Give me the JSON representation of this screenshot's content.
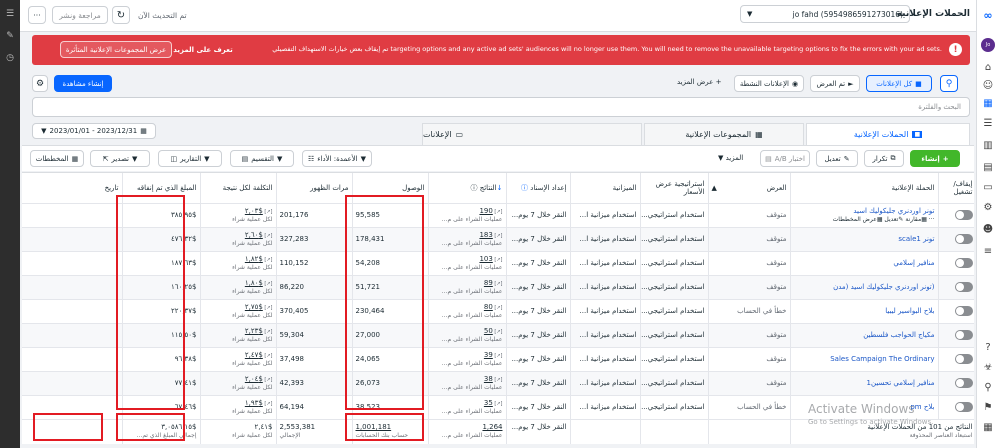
{
  "header": {
    "title": "الحملات الإعلانية",
    "account": "jo fahd (5954986591273016)",
    "updated": "تم التحديث الآن",
    "review_publish": "مراجعة ونشر",
    "more": "···"
  },
  "banner": {
    "text": "تم إيقاف بعض خيارات الاستهداف التفصيلي targeting options and any active ad sets' audiences will no longer use them. You will need to remove the unavailable targeting options to fix the errors with your ad sets.",
    "learn_more": "تعرف على المزيد",
    "view_affected": "عرض المجموعات الإعلانية المتأثرة"
  },
  "filters": {
    "all_ads": "كل الإعلانات",
    "shown": "تم العرض",
    "active_ads": "الإعلانات النشطة",
    "show_more": "عرض المزيد",
    "create_view": "إنشاء مشاهدة"
  },
  "search": {
    "placeholder": "البحث والفلترة"
  },
  "tabs": {
    "campaigns": "الحملات الإعلانية",
    "adsets": "المجموعات الإعلانية",
    "ads": "الإعلانات"
  },
  "date_range": "2023/01/01 - 2023/12/31",
  "toolbar": {
    "create": "إنشاء",
    "duplicate": "تكرار",
    "edit": "تعديل",
    "ab_test": "اختبار A/B",
    "more": "المزيد",
    "columns": "الأعمدة: الأداء",
    "breakdown": "التقسيم",
    "reports": "التقارير",
    "export": "تصدير",
    "charts": "المخططات"
  },
  "columns": {
    "toggle": "إيقاف/تشغيل",
    "campaign": "الحملة الإعلانية",
    "delivery": "العرض",
    "bid_strategy": "استراتيجية عرض الأسعار",
    "budget": "الميزانية",
    "attribution": "إعداد الإسناد",
    "results": "النتائج",
    "reach": "الوصول",
    "impressions": "مرات الظهور",
    "cost_per_result": "التكلفة لكل نتيجة",
    "amount_spent": "المبلغ الذي تم إنفاقه",
    "ends": "تاريخ"
  },
  "row_hover": {
    "charts": "عرض المخططات",
    "edit": "تعديل",
    "compare": "مقارنة"
  },
  "rows": [
    {
      "name": "تونر اوردنري جليكوليك اسيد",
      "delivery": "متوقف",
      "bid": "استخدام استراتيجي...",
      "budget": "استخدام ميزانية ا...",
      "attribution": "النقر خلال 7 يوم...",
      "results": "190",
      "results_sub": "عمليات الشراء على م...",
      "reach": "95,585",
      "impressions": "201,176",
      "cpr": "$٢,٠٣",
      "cpr_sub": "لكل عملية شراء",
      "spent": "$٣٨٥,٩٥"
    },
    {
      "name": "تونر scale1",
      "delivery": "متوقف",
      "bid": "استخدام استراتيجي...",
      "budget": "استخدام ميزانية ا...",
      "attribution": "النقر خلال 7 يوم...",
      "results": "183",
      "results_sub": "عمليات الشراء على م...",
      "reach": "178,431",
      "impressions": "327,283",
      "cpr": "$٢,٦٠",
      "cpr_sub": "لكل عملية شراء",
      "spent": "$٤٧٦,٣٢"
    },
    {
      "name": "منافير إسلامي",
      "delivery": "متوقف",
      "bid": "استخدام استراتيجي...",
      "budget": "استخدام ميزانية ا...",
      "attribution": "النقر خلال 7 يوم...",
      "results": "103",
      "results_sub": "عمليات الشراء على م...",
      "reach": "54,208",
      "impressions": "110,152",
      "cpr": "$١,٨٢",
      "cpr_sub": "لكل عملية شراء",
      "spent": "$١٨٧,٦٣"
    },
    {
      "name": "(تونر اوردنري جليكوليك اسيد (مدن",
      "delivery": "متوقف",
      "bid": "استخدام استراتيجي...",
      "budget": "استخدام ميزانية ا...",
      "attribution": "النقر خلال 7 يوم...",
      "results": "89",
      "results_sub": "عمليات الشراء على م...",
      "reach": "51,721",
      "impressions": "86,220",
      "cpr": "$١,٨٠",
      "cpr_sub": "لكل عملية شراء",
      "spent": "$١٦٠,٢٥"
    },
    {
      "name": "بلاح البواسير ليبيا",
      "delivery": "خطأ في الحساب",
      "bid": "استخدام استراتيجي...",
      "budget": "استخدام ميزانية ا...",
      "attribution": "النقر خلال 7 يوم...",
      "results": "80",
      "results_sub": "عمليات الشراء على م...",
      "reach": "230,464",
      "impressions": "370,405",
      "cpr": "$٢,٧٥",
      "cpr_sub": "لكل عملية شراء",
      "spent": "$٢٢٠,٣٧"
    },
    {
      "name": "مكياج الحواجب فلسطين",
      "delivery": "متوقف",
      "bid": "استخدام استراتيجي...",
      "budget": "استخدام ميزانية ا...",
      "attribution": "النقر خلال 7 يوم...",
      "results": "50",
      "results_sub": "عمليات الشراء على م...",
      "reach": "27,000",
      "impressions": "59,304",
      "cpr": "$٢,٢٣",
      "cpr_sub": "لكل عملية شراء",
      "spent": "$١١٥,٥٠"
    },
    {
      "name": "Sales Campaign The Ordinary",
      "delivery": "متوقف",
      "bid": "استخدام استراتيجي...",
      "budget": "استخدام ميزانية ا...",
      "attribution": "النقر خلال 7 يوم...",
      "results": "39",
      "results_sub": "عمليات الشراء على م...",
      "reach": "24,065",
      "impressions": "37,498",
      "cpr": "$٢,٤٧",
      "cpr_sub": "لكل عملية شراء",
      "spent": "$٩٦,٣٨"
    },
    {
      "name": "منافير إسلامي تحسين1",
      "delivery": "متوقف",
      "bid": "استخدام استراتيجي...",
      "budget": "استخدام ميزانية ا...",
      "attribution": "النقر خلال 7 يوم...",
      "results": "38",
      "results_sub": "عمليات الشراء على م...",
      "reach": "26,073",
      "impressions": "42,393",
      "cpr": "$٢,٠٤",
      "cpr_sub": "لكل عملية شراء",
      "spent": "$٧٧,٤١"
    },
    {
      "name": "بلاح pm",
      "delivery": "خطأ في الحساب",
      "bid": "استخدام استراتيجي...",
      "budget": "استخدام ميزانية ا...",
      "attribution": "النقر خلال 7 يوم...",
      "results": "35",
      "results_sub": "عمليات الشراء على م...",
      "reach": "38,523",
      "impressions": "64,194",
      "cpr": "$١,٩٣",
      "cpr_sub": "لكل عملية شراء",
      "spent": "$٦٧,٤٦"
    }
  ],
  "totals": {
    "label": "النتائج من 101 من الحملات الإعلانية",
    "label_sub": "استبعاد العناصر المحذوفة",
    "attribution": "النقر خلال 7 يوم...",
    "results": "1,264",
    "results_sub": "عمليات الشراء على م...",
    "reach": "1,001,181",
    "reach_sub": "حساب بنك الحسابات",
    "impressions": "2,553,381",
    "impressions_sub": "الإجمالي",
    "cpr": "$٢,٤١",
    "cpr_sub": "لكل عملية شراء",
    "spent": "$٣,٠٥٨٦,١٥",
    "spent_sub": "إجمالي المبلغ الذي تم..."
  },
  "watermark": {
    "title": "Activate Windows",
    "sub": "Go to Settings to activate Windows."
  },
  "colors": {
    "primary": "#0866ff",
    "create_green": "#42b72a",
    "banner_red": "#e03c43",
    "highlight": "#e21b23"
  }
}
